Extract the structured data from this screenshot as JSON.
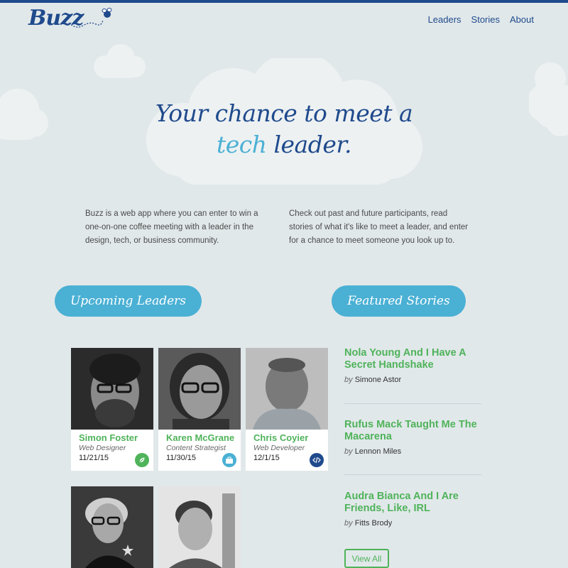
{
  "header": {
    "logo": "Buzz",
    "nav": [
      "Leaders",
      "Stories",
      "About"
    ]
  },
  "hero": {
    "line1": "Your chance to meet a",
    "line2_accent": "tech",
    "line2_rest": " leader."
  },
  "intro": {
    "left": "Buzz is a web app where you can enter to win a one-on-one coffee meeting with a leader in the design, tech, or business community.",
    "right": "Check out past and future participants, read stories of what it's like to meet a leader, and enter for a chance to meet someone you look up to."
  },
  "sections": {
    "leaders_label": "Upcoming Leaders",
    "stories_label": "Featured Stories"
  },
  "leaders": [
    {
      "name": "Simon Foster",
      "role": "Web Designer",
      "date": "11/21/15",
      "badge_icon": "leaf-icon",
      "badge_color": "#4fb35a"
    },
    {
      "name": "Karen McGrane",
      "role": "Content Strategist",
      "date": "11/30/15",
      "badge_icon": "briefcase-icon",
      "badge_color": "#4ab0d4"
    },
    {
      "name": "Chris Coyier",
      "role": "Web Developer",
      "date": "12/1/15",
      "badge_icon": "code-icon",
      "badge_color": "#1f4a8c"
    }
  ],
  "stories": [
    {
      "title": "Nola Young And I Have A Secret Handshake",
      "by": "by",
      "author": "Simone Astor"
    },
    {
      "title": "Rufus Mack Taught Me The Macarena",
      "by": "by",
      "author": "Lennon Miles"
    },
    {
      "title": "Audra Bianca And I Are Friends, Like, IRL",
      "by": "by",
      "author": "Fitts Brody"
    }
  ],
  "view_all_label": "View All",
  "colors": {
    "brand_blue": "#1f4a8c",
    "accent_cyan": "#4ab0d4",
    "green": "#4fb35a",
    "background": "#e1e8ea"
  }
}
